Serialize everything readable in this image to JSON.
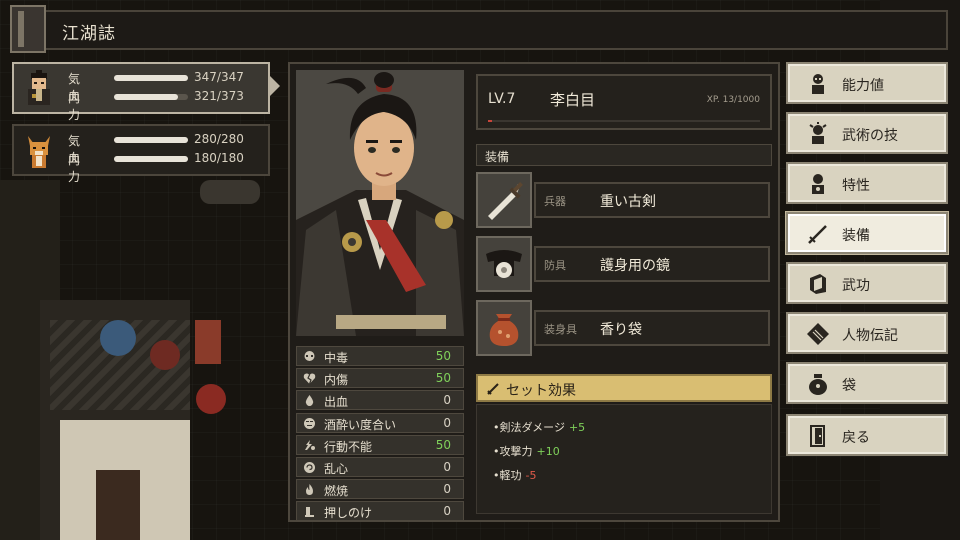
{
  "header": {
    "title": "江湖誌"
  },
  "party": [
    {
      "stats": [
        {
          "label": "気血",
          "value": "347/347",
          "fill": 1.0
        },
        {
          "label": "内力",
          "value": "321/373",
          "fill": 0.86
        }
      ],
      "active": true
    },
    {
      "stats": [
        {
          "label": "気血",
          "value": "280/280",
          "fill": 1.0
        },
        {
          "label": "内力",
          "value": "180/180",
          "fill": 1.0
        }
      ],
      "active": false
    }
  ],
  "character": {
    "level": "LV.7",
    "name": "李白目",
    "xp": "XP. 13/1000",
    "xp_fraction": 0.013
  },
  "equipment": {
    "header": "装備",
    "slots": [
      {
        "type": "兵器",
        "item": "重い古剣",
        "icon": "sword-icon"
      },
      {
        "type": "防具",
        "item": "護身用の鏡",
        "icon": "mirror-armor-icon"
      },
      {
        "type": "装身具",
        "item": "香り袋",
        "icon": "scent-pouch-icon"
      }
    ]
  },
  "set_effect": {
    "title": "セット効果",
    "lines": [
      {
        "text": "•剣法ダメージ",
        "mod": "+5",
        "kind": "plus"
      },
      {
        "text": "•攻撃力",
        "mod": "+10",
        "kind": "plus"
      },
      {
        "text": "•軽功",
        "mod": "-5",
        "kind": "minus"
      }
    ]
  },
  "status_effects": [
    {
      "name": "中毒",
      "value": "50",
      "green": true,
      "icon": "skull-icon"
    },
    {
      "name": "内傷",
      "value": "50",
      "green": true,
      "icon": "broken-heart-icon"
    },
    {
      "name": "出血",
      "value": "0",
      "green": false,
      "icon": "blood-drop-icon"
    },
    {
      "name": "酒酔い度合い",
      "value": "0",
      "green": false,
      "icon": "drunk-face-icon"
    },
    {
      "name": "行動不能",
      "value": "50",
      "green": true,
      "icon": "stun-icon"
    },
    {
      "name": "乱心",
      "value": "0",
      "green": false,
      "icon": "confusion-icon"
    },
    {
      "name": "燃焼",
      "value": "0",
      "green": false,
      "icon": "fire-icon"
    },
    {
      "name": "押しのけ",
      "value": "0",
      "green": false,
      "icon": "push-back-icon"
    }
  ],
  "menu": [
    {
      "label": "能力値",
      "icon": "person-stats-icon",
      "selected": false
    },
    {
      "label": "武術の技",
      "icon": "martial-skill-icon",
      "selected": false
    },
    {
      "label": "特性",
      "icon": "trait-icon",
      "selected": false
    },
    {
      "label": "装備",
      "icon": "equipment-sword-icon",
      "selected": true
    },
    {
      "label": "武功",
      "icon": "martial-book-icon",
      "selected": false
    },
    {
      "label": "人物伝記",
      "icon": "biography-icon",
      "selected": false
    },
    {
      "label": "袋",
      "icon": "bag-icon",
      "selected": false
    },
    {
      "label": "戻る",
      "icon": "exit-door-icon",
      "selected": false
    }
  ],
  "colors": {
    "positive": "#7fd05a",
    "negative": "#e05a4a",
    "set_header": "#d9be72",
    "menu_button": "#d9d3c0"
  }
}
